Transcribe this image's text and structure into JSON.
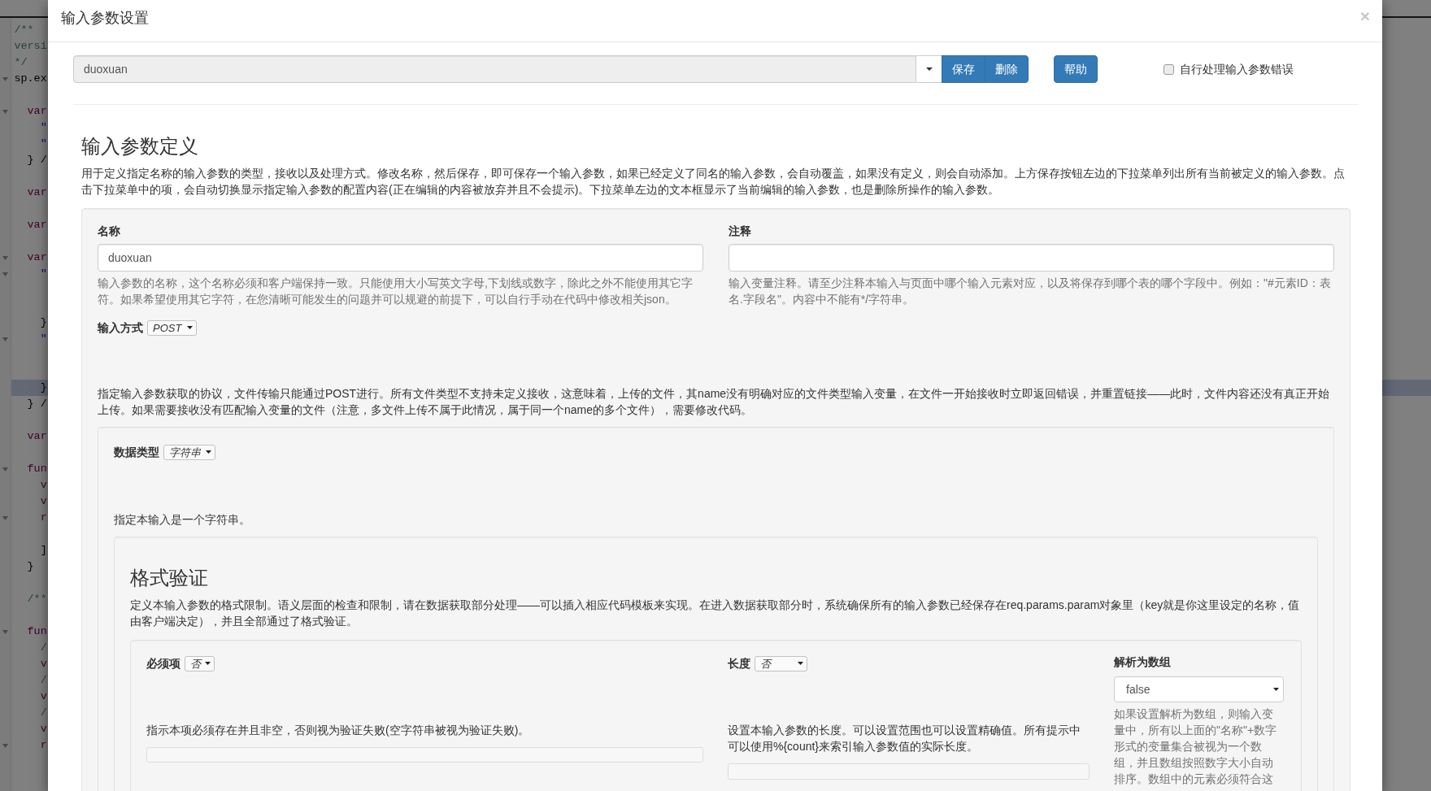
{
  "editor": {
    "lines": [
      {
        "text": "/**",
        "kind": "comment",
        "fold": false,
        "active": false
      },
      {
        "text": "versi",
        "kind": "comment",
        "fold": false,
        "active": false
      },
      {
        "text": "*/",
        "kind": "comment",
        "fold": false,
        "active": false
      },
      {
        "text": "sp.ex",
        "kind": "plain",
        "fold": true,
        "active": false
      },
      {
        "fold": false,
        "active": false
      },
      {
        "text": "  var",
        "kind": "keyword",
        "fold": true,
        "active": false
      },
      {
        "text": "    \"",
        "kind": "string",
        "fold": false,
        "active": false
      },
      {
        "text": "    \"",
        "kind": "string",
        "fold": false,
        "active": false
      },
      {
        "text": "  } /",
        "kind": "plain",
        "fold": false,
        "active": false
      },
      {
        "fold": false,
        "active": false
      },
      {
        "text": "  var",
        "kind": "keyword",
        "fold": false,
        "active": false
      },
      {
        "fold": false,
        "active": false
      },
      {
        "text": "  var",
        "kind": "keyword",
        "fold": false,
        "active": false
      },
      {
        "fold": false,
        "active": false
      },
      {
        "text": "  var",
        "kind": "keyword",
        "fold": true,
        "active": false
      },
      {
        "text": "    \"",
        "kind": "string",
        "fold": true,
        "active": false
      },
      {
        "fold": false,
        "active": false
      },
      {
        "fold": false,
        "active": false
      },
      {
        "text": "    }",
        "kind": "plain",
        "fold": false,
        "active": false
      },
      {
        "text": "    \"",
        "kind": "string",
        "fold": true,
        "active": false
      },
      {
        "fold": false,
        "active": false
      },
      {
        "fold": false,
        "active": false
      },
      {
        "text": "    }",
        "kind": "plain",
        "fold": false,
        "active": true
      },
      {
        "text": "  } /",
        "kind": "plain",
        "fold": false,
        "active": false
      },
      {
        "fold": false,
        "active": false
      },
      {
        "text": "  var",
        "kind": "keyword",
        "fold": false,
        "active": false
      },
      {
        "fold": false,
        "active": false
      },
      {
        "text": "  fun",
        "kind": "keyword",
        "fold": true,
        "active": false
      },
      {
        "text": "    v",
        "kind": "keyword",
        "fold": false,
        "active": false
      },
      {
        "text": "    v",
        "kind": "keyword",
        "fold": false,
        "active": false
      },
      {
        "text": "    r",
        "kind": "keyword",
        "fold": true,
        "active": false
      },
      {
        "fold": false,
        "active": false
      },
      {
        "text": "    ]",
        "kind": "plain",
        "fold": false,
        "active": false
      },
      {
        "text": "  }",
        "kind": "plain",
        "fold": false,
        "active": false
      },
      {
        "fold": false,
        "active": false
      },
      {
        "text": "  /**",
        "kind": "comment",
        "fold": false,
        "active": false
      },
      {
        "fold": false,
        "active": false
      },
      {
        "text": "  fun",
        "kind": "keyword",
        "fold": true,
        "active": false
      },
      {
        "text": "    /",
        "kind": "comment",
        "fold": false,
        "active": false
      },
      {
        "text": "    v",
        "kind": "keyword",
        "fold": false,
        "active": false
      },
      {
        "text": "    /",
        "kind": "comment",
        "fold": false,
        "active": false
      },
      {
        "text": "    v",
        "kind": "keyword",
        "fold": false,
        "active": false
      },
      {
        "text": "    /",
        "kind": "comment",
        "fold": false,
        "active": false
      },
      {
        "text": "    v",
        "kind": "keyword",
        "fold": false,
        "active": false
      },
      {
        "text": "    r",
        "kind": "keyword",
        "fold": true,
        "active": false
      }
    ]
  },
  "dialog": {
    "title": "输入参数设置",
    "close": "×",
    "toolbar": {
      "selector_value": "duoxuan",
      "buttons": [
        {
          "label": "保存",
          "kind": "group"
        },
        {
          "label": "删除",
          "kind": "group"
        },
        {
          "label": "帮助",
          "kind": "single"
        }
      ],
      "checkbox": {
        "label": "自行处理输入参数错误",
        "checked": false
      }
    },
    "section": {
      "title": "输入参数定义",
      "description": "用于定义指定名称的输入参数的类型，接收以及处理方式。修改名称，然后保存，即可保存一个输入参数，如果已经定义了同名的输入参数，会自动覆盖，如果没有定义，则会自动添加。上方保存按钮左边的下拉菜单列出所有当前被定义的输入参数。点击下拉菜单中的项，会自动切换显示指定输入参数的配置内容(正在编辑的内容被放弃并且不会提示)。下拉菜单左边的文本框显示了当前编辑的输入参数，也是删除所操作的输入参数。",
      "name_field": {
        "label": "名称",
        "value": "duoxuan",
        "help": "输入参数的名称，这个名称必须和客户端保持一致。只能使用大小写英文字母,下划线或数字，除此之外不能使用其它字符。如果希望使用其它字符，在您清晰可能发生的问题并可以规避的前提下，可以自行手动在代码中修改相关json。"
      },
      "comment_field": {
        "label": "注释",
        "help": "输入变量注释。请至少注释本输入与页面中哪个输入元素对应，以及将保存到哪个表的哪个字段中。例如：\"#元素ID：表名.字段名\"。内容中不能有*/字符串。"
      },
      "input_method": {
        "label": "输入方式",
        "value": "POST",
        "description": "指定输入参数获取的协议，文件传输只能通过POST进行。所有文件类型不支持未定义接收，这意味着，上传的文件，其name没有明确对应的文件类型输入变量，在文件一开始接收时立即返回错误，并重置链接——此时，文件内容还没有真正开始上传。如果需要接收没有匹配输入变量的文件（注意，多文件上传不属于此情况，属于同一个name的多个文件），需要修改代码。"
      },
      "data_type": {
        "label": "数据类型",
        "value": "字符串",
        "description": "指定本输入是一个字符串。"
      },
      "validation": {
        "title": "格式验证",
        "description": "定义本输入参数的格式限制。语义层面的检查和限制，请在数据获取部分处理——可以插入相应代码模板来实现。在进入数据获取部分时，系统确保所有的输入参数已经保存在req.params.param对象里（key就是你这里设定的名称，值由客户端决定），并且全部通过了格式验证。",
        "required": {
          "label": "必须项",
          "value": "否",
          "help": "指示本项必须存在并且非空，否则视为验证失败(空字符串被视为验证失败)。"
        },
        "length": {
          "label": "长度",
          "value": "否",
          "help": "设置本输入参数的长度。可以设置范围也可以设置精确值。所有提示中可以使用%{count}来索引输入参数值的实际长度。"
        },
        "parse_array": {
          "label": "解析为数组",
          "value": "false",
          "help": "如果设置解析为数组，则输入变量中，所有以上面的\"名称\"+数字形式的变量集合被视为一个数组，并且数组按照数字大小自动排序。数组中的元素必须符合这"
        }
      }
    }
  }
}
